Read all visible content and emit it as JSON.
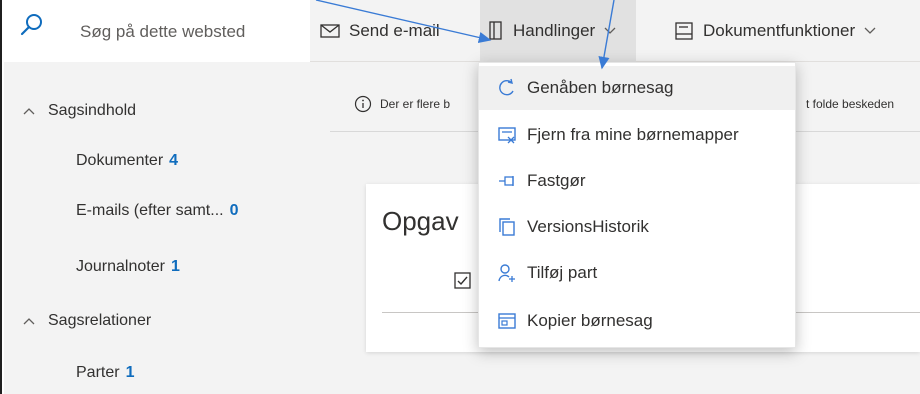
{
  "sidebar": {
    "search_placeholder": "Søg på dette websted",
    "sections": [
      {
        "label": "Sagsindhold"
      },
      {
        "label": "Sagsrelationer"
      }
    ],
    "items": [
      {
        "label": "Dokumenter",
        "count": "4"
      },
      {
        "label": "E-mails (efter samt...",
        "count": "0"
      },
      {
        "label": "Journalnoter",
        "count": "1"
      },
      {
        "label": "Parter",
        "count": "1"
      }
    ]
  },
  "commandbar": {
    "send_email": "Send e-mail",
    "handlinger": "Handlinger",
    "dokumentfunktioner": "Dokumentfunktioner"
  },
  "main": {
    "info_text": "Der er flere b",
    "info_text_2": "t folde beskeden",
    "card_title": "Opgav"
  },
  "dropdown": {
    "items": [
      {
        "label": "Genåben børnesag",
        "icon": "reopen-icon"
      },
      {
        "label": "Fjern fra mine børnemapper",
        "icon": "remove-folder-icon"
      },
      {
        "label": "Fastgør",
        "icon": "pin-icon"
      },
      {
        "label": "VersionsHistorik",
        "icon": "version-history-icon"
      },
      {
        "label": "Tilføj part",
        "icon": "add-person-icon"
      },
      {
        "label": "Kopier børnesag",
        "icon": "copy-case-icon"
      }
    ]
  },
  "colors": {
    "accent": "#0f6cbd",
    "arrow": "#3a7bd5"
  }
}
